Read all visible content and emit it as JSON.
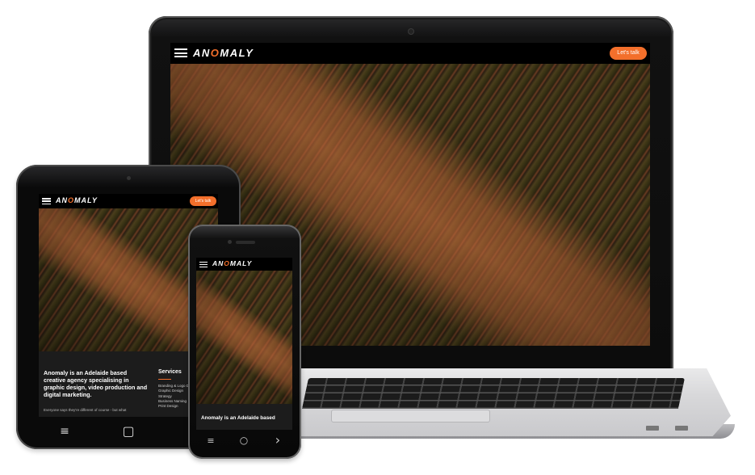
{
  "brand": {
    "logo_prefix": "AN",
    "logo_o": "O",
    "logo_suffix": "MALY",
    "accent": "#f36f2b"
  },
  "laptop": {
    "cta": "Let's talk"
  },
  "tablet": {
    "cta": "Let's talk",
    "headline": "Anomaly is an Adelaide based creative agency specialising in graphic design, video production and digital marketing.",
    "body": "Everyone says they're different of course - but what",
    "services_title": "Services",
    "services": [
      "Branding & Logo D",
      "Graphic Design",
      "Strategy",
      "Business Naming",
      "Print Design"
    ],
    "nav_buttons": {
      "menu": "≡",
      "home": "▢"
    }
  },
  "phone": {
    "headline": "Anomaly is an Adelaide based",
    "nav_buttons": {
      "menu": "≡",
      "home": "○",
      "back": "›"
    }
  },
  "icons": [
    "hamburger-icon",
    "menu-icon",
    "home-icon",
    "back-icon"
  ]
}
